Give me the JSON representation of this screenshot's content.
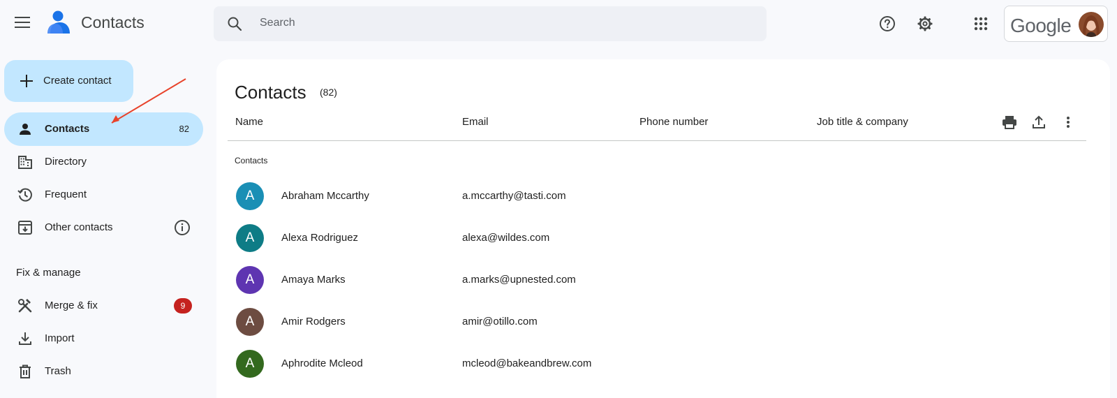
{
  "header": {
    "app_title": "Contacts",
    "search_placeholder": "Search",
    "account_label": "Google",
    "icons": [
      "menu-icon",
      "help-icon",
      "settings-icon",
      "apps-icon"
    ]
  },
  "sidebar": {
    "create_label": "Create contact",
    "items": [
      {
        "label": "Contacts",
        "count": "82",
        "icon": "person-icon",
        "active": true
      },
      {
        "label": "Directory",
        "icon": "building-icon"
      },
      {
        "label": "Frequent",
        "icon": "history-icon"
      },
      {
        "label": "Other contacts",
        "icon": "archive-download-icon"
      }
    ],
    "section_title": "Fix & manage",
    "manage_items": [
      {
        "label": "Merge & fix",
        "badge": "9",
        "icon": "tools-icon"
      },
      {
        "label": "Import",
        "icon": "download-icon"
      },
      {
        "label": "Trash",
        "icon": "trash-icon"
      }
    ]
  },
  "main": {
    "title": "Contacts",
    "count": "(82)",
    "columns": [
      "Name",
      "Email",
      "Phone number",
      "Job title & company"
    ],
    "group_label": "Contacts",
    "rows": [
      {
        "initial": "A",
        "name": "Abraham Mccarthy",
        "email": "a.mccarthy@tasti.com",
        "color": "#1a8fb5"
      },
      {
        "initial": "A",
        "name": "Alexa Rodriguez",
        "email": "alexa@wildes.com",
        "color": "#0e7c86"
      },
      {
        "initial": "A",
        "name": "Amaya Marks",
        "email": "a.marks@upnested.com",
        "color": "#5e35b1"
      },
      {
        "initial": "A",
        "name": "Amir Rodgers",
        "email": "amir@otillo.com",
        "color": "#6d4c41"
      },
      {
        "initial": "A",
        "name": "Aphrodite Mcleod",
        "email": "mcleod@bakeandbrew.com",
        "color": "#33691e"
      }
    ]
  },
  "colors": {
    "accent": "#c2e7ff",
    "badge": "#c5221f",
    "annotation_arrow": "#e8432b"
  }
}
